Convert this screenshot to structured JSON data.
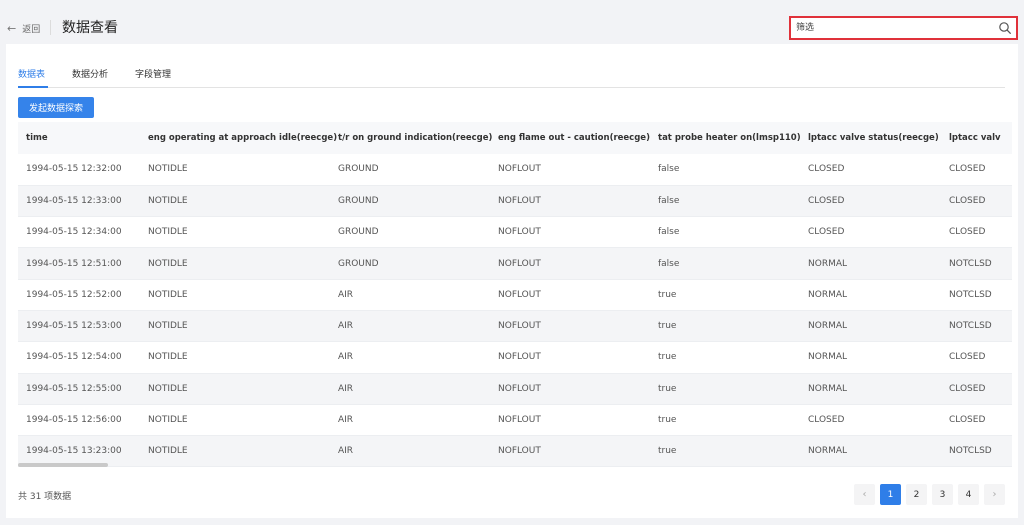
{
  "header": {
    "back_label": "返回",
    "back_arrow": "←",
    "title": "数据查看",
    "filter_placeholder": "筛选"
  },
  "tabs": [
    {
      "label": "数据表",
      "active": true
    },
    {
      "label": "数据分析",
      "active": false
    },
    {
      "label": "字段管理",
      "active": false
    }
  ],
  "explore_button_label": "发起数据探索",
  "table": {
    "columns": [
      "time",
      "eng operating at approach idle(reecge)",
      "t/r on ground indication(reecge)",
      "eng flame out - caution(reecge)",
      "tat probe heater on(lmsp110)",
      "lptacc valve status(reecge)",
      "lptacc valv"
    ],
    "rows": [
      [
        "1994-05-15 12:32:00",
        "NOTIDLE",
        "GROUND",
        "NOFLOUT",
        "false",
        "CLOSED",
        "CLOSED"
      ],
      [
        "1994-05-15 12:33:00",
        "NOTIDLE",
        "GROUND",
        "NOFLOUT",
        "false",
        "CLOSED",
        "CLOSED"
      ],
      [
        "1994-05-15 12:34:00",
        "NOTIDLE",
        "GROUND",
        "NOFLOUT",
        "false",
        "CLOSED",
        "CLOSED"
      ],
      [
        "1994-05-15 12:51:00",
        "NOTIDLE",
        "GROUND",
        "NOFLOUT",
        "false",
        "NORMAL",
        "NOTCLSD"
      ],
      [
        "1994-05-15 12:52:00",
        "NOTIDLE",
        "AIR",
        "NOFLOUT",
        "true",
        "NORMAL",
        "NOTCLSD"
      ],
      [
        "1994-05-15 12:53:00",
        "NOTIDLE",
        "AIR",
        "NOFLOUT",
        "true",
        "NORMAL",
        "NOTCLSD"
      ],
      [
        "1994-05-15 12:54:00",
        "NOTIDLE",
        "AIR",
        "NOFLOUT",
        "true",
        "NORMAL",
        "CLOSED"
      ],
      [
        "1994-05-15 12:55:00",
        "NOTIDLE",
        "AIR",
        "NOFLOUT",
        "true",
        "NORMAL",
        "CLOSED"
      ],
      [
        "1994-05-15 12:56:00",
        "NOTIDLE",
        "AIR",
        "NOFLOUT",
        "true",
        "CLOSED",
        "CLOSED"
      ],
      [
        "1994-05-15 13:23:00",
        "NOTIDLE",
        "AIR",
        "NOFLOUT",
        "true",
        "NORMAL",
        "NOTCLSD"
      ]
    ]
  },
  "footer": {
    "total_label": "共 31 项数据",
    "prev_icon": "‹",
    "next_icon": "›",
    "pages": [
      "1",
      "2",
      "3",
      "4"
    ],
    "current_page": "1"
  },
  "colors": {
    "accent": "#2f7ee8",
    "highlight_border": "#e0313a"
  }
}
